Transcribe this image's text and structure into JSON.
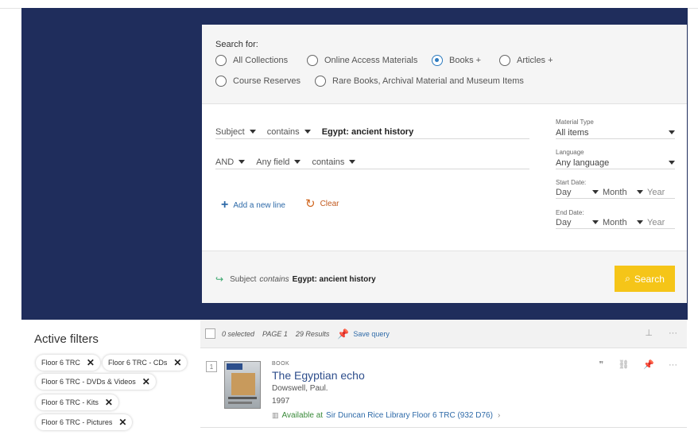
{
  "search": {
    "scope_title": "Search for:",
    "scopes": [
      "All Collections",
      "Online Access Materials",
      "Books +",
      "Articles +",
      "Course Reserves",
      "Rare Books, Archival Material and Museum Items"
    ],
    "selected_scope": "Books +",
    "line1": {
      "field": "Subject",
      "operator": "contains",
      "term": "Egypt: ancient history"
    },
    "line2": {
      "bool": "AND",
      "field": "Any field",
      "operator": "contains",
      "term": ""
    },
    "add_line_label": "Add a new line",
    "clear_label": "Clear",
    "material_type": {
      "label": "Material Type",
      "value": "All items"
    },
    "language": {
      "label": "Language",
      "value": "Any language"
    },
    "start_date": {
      "label": "Start Date:",
      "day": "Day",
      "month": "Month",
      "year": "Year"
    },
    "end_date": {
      "label": "End Date:",
      "day": "Day",
      "month": "Month",
      "year": "Year"
    },
    "summary": {
      "field": "Subject",
      "operator": "contains",
      "term": "Egypt: ancient history"
    },
    "search_button": "Search"
  },
  "filters": {
    "title": "Active filters",
    "chips": [
      "Floor 6 TRC",
      "Floor 6 TRC - CDs",
      "Floor 6 TRC - DVDs & Videos",
      "Floor 6 TRC - Kits",
      "Floor 6 TRC - Pictures"
    ]
  },
  "results_bar": {
    "selected": "0 selected",
    "page": "PAGE 1",
    "count": "29 Results",
    "save_query": "Save query"
  },
  "result": {
    "number": "1",
    "type": "BOOK",
    "title": "The Egyptian echo",
    "author": "Dowswell, Paul.",
    "year": "1997",
    "availability": "Available at",
    "location": "Sir Duncan Rice Library  Floor 6 TRC (932 D76)",
    "cover_text": "ECHO"
  },
  "colors": {
    "header_bg": "#1f2d5c",
    "search_button": "#f5c518",
    "link": "#2e6aa8",
    "available": "#3a8a3a",
    "clear": "#c25a1f"
  },
  "icons": [
    "radio-button",
    "caret-down-icon",
    "plus-icon",
    "refresh-icon",
    "arrow-right-icon",
    "search-icon",
    "close-icon",
    "pin-icon",
    "quote-icon",
    "link-icon",
    "more-icon",
    "book-icon",
    "chevron-right-icon"
  ]
}
